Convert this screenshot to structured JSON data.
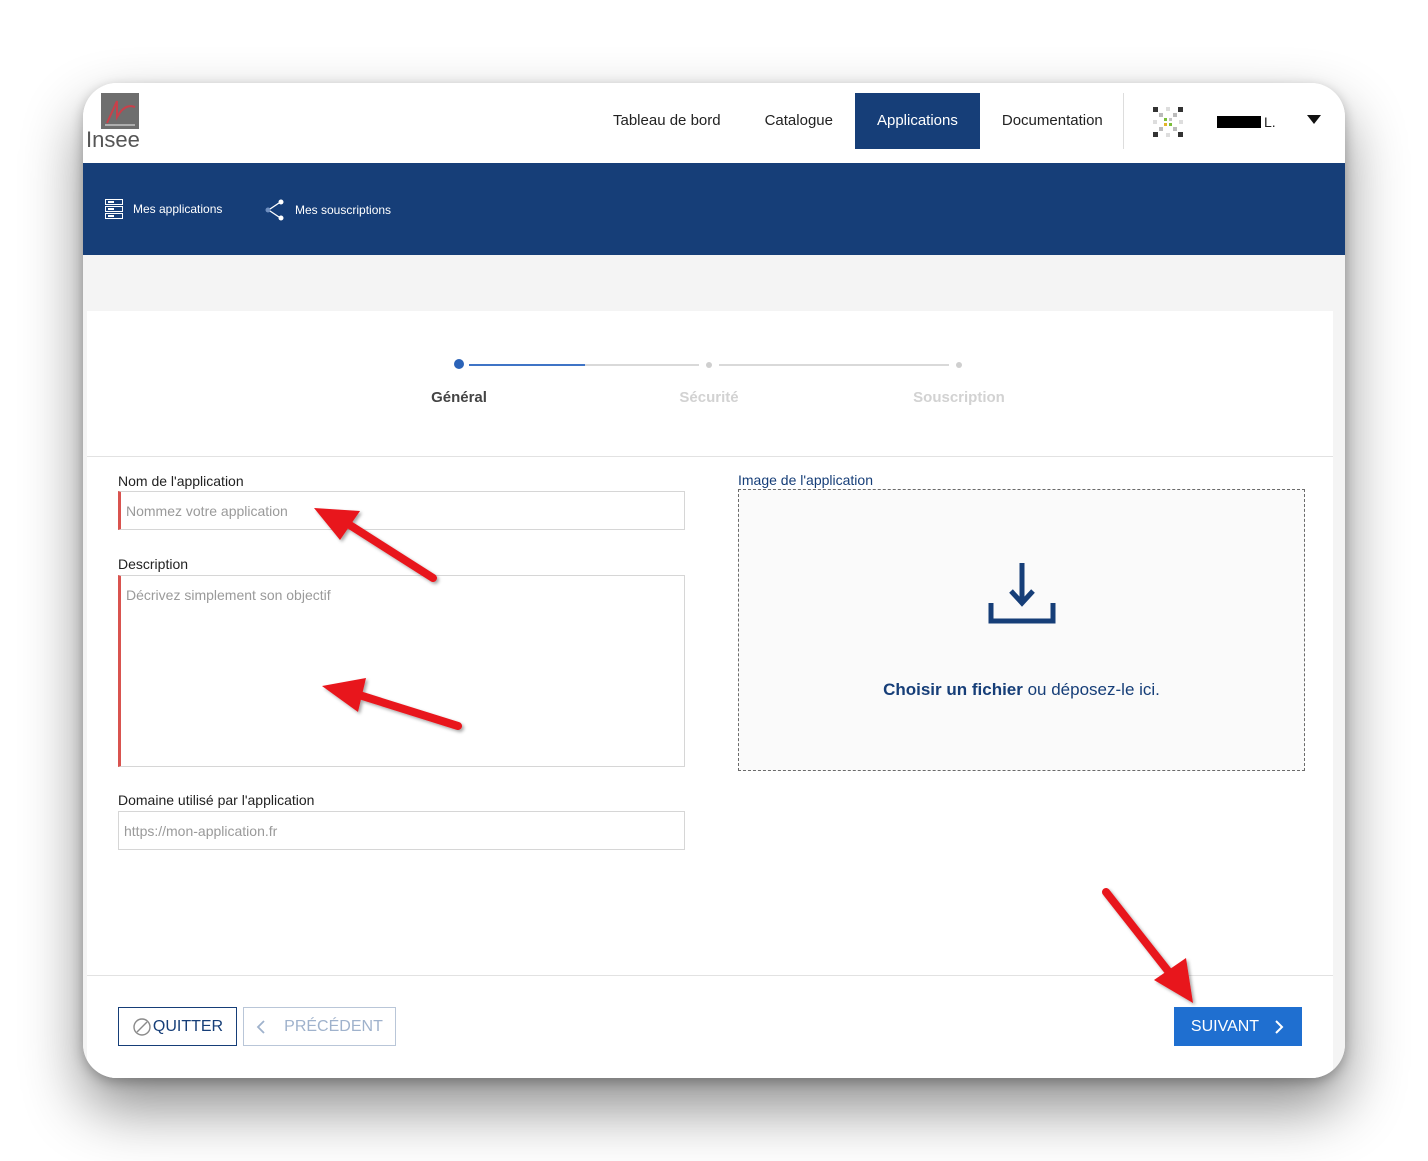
{
  "header": {
    "logo_text": "Insee",
    "nav": [
      {
        "label": "Tableau de bord",
        "active": false
      },
      {
        "label": "Catalogue",
        "active": false
      },
      {
        "label": "Applications",
        "active": true
      },
      {
        "label": "Documentation",
        "active": false
      }
    ],
    "user_name_suffix": "L."
  },
  "subnav": {
    "my_apps": "Mes applications",
    "my_subscriptions": "Mes souscriptions"
  },
  "stepper": {
    "steps": [
      {
        "label": "Général",
        "state": "current"
      },
      {
        "label": "Sécurité",
        "state": "upcoming"
      },
      {
        "label": "Souscription",
        "state": "upcoming"
      }
    ]
  },
  "form": {
    "name_label": "Nom de l'application",
    "name_placeholder": "Nommez votre application",
    "description_label": "Description",
    "description_placeholder": "Décrivez simplement son objectif",
    "domain_label": "Domaine utilisé par l'application",
    "domain_placeholder": "https://mon-application.fr",
    "image_label": "Image de l'application",
    "dropzone_choose": "Choisir un fichier",
    "dropzone_rest": " ou déposez-le ici."
  },
  "buttons": {
    "quit": "QUITTER",
    "previous": "PRÉCÉDENT",
    "next": "SUIVANT"
  },
  "colors": {
    "brand": "#163e78",
    "primary_button": "#1f6fd0",
    "error": "#d9534f",
    "annotation_arrow": "#e8141b"
  }
}
